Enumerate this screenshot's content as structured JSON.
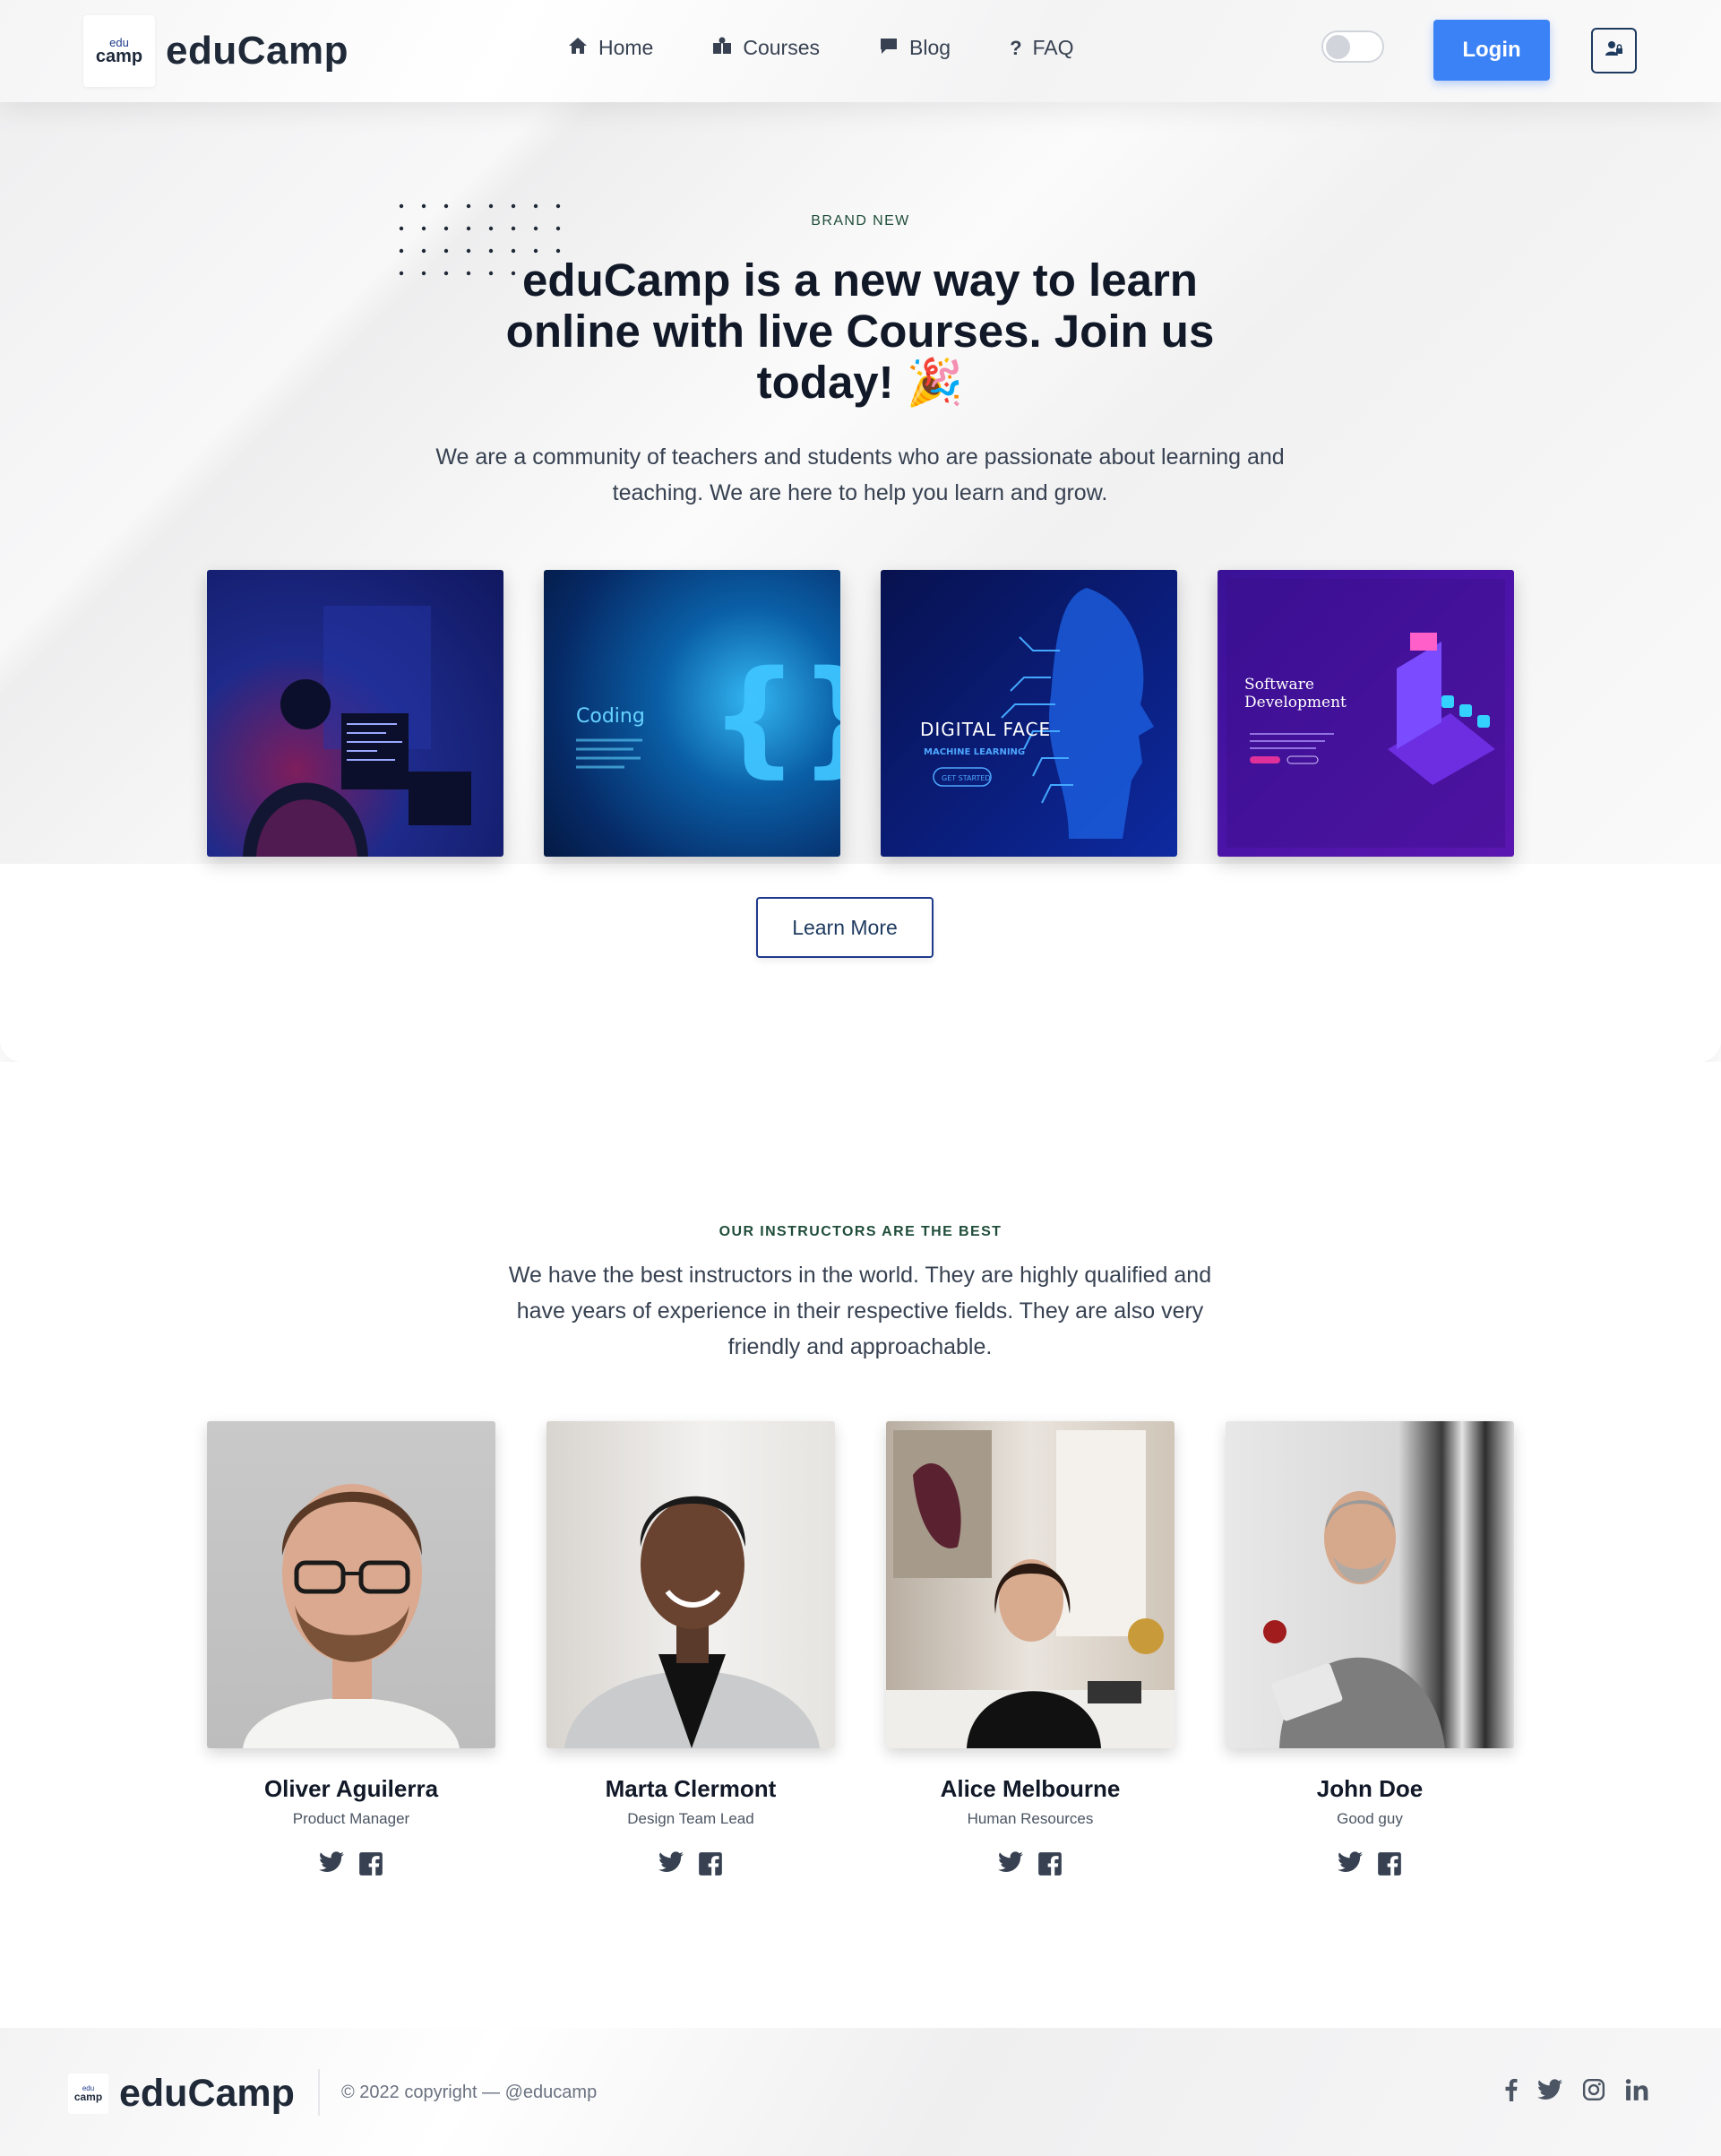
{
  "header": {
    "logo_top": "edu",
    "logo_bottom": "camp",
    "brand": "eduCamp",
    "nav": [
      {
        "label": "Home",
        "icon": "home-icon"
      },
      {
        "label": "Courses",
        "icon": "courses-icon"
      },
      {
        "label": "Blog",
        "icon": "blog-icon"
      },
      {
        "label": "FAQ",
        "icon": "question-icon"
      }
    ],
    "login_label": "Login",
    "theme_toggle": "off"
  },
  "hero": {
    "eyebrow": "BRAND NEW",
    "title": "eduCamp is a new way to learn online with live Courses. Join us today!",
    "title_emoji": "🎉",
    "description": "We are a community of teachers and students who are passionate about learning and teaching. We are here to help you learn and grow.",
    "tiles": [
      {
        "label": ""
      },
      {
        "label": "Coding"
      },
      {
        "label": "DIGITAL FACE",
        "sub": "MACHINE LEARNING",
        "cta": "GET STARTED"
      },
      {
        "label": "Software Development"
      }
    ],
    "learn_more": "Learn More"
  },
  "instructors": {
    "eyebrow": "OUR INSTRUCTORS ARE THE BEST",
    "description": "We have the best instructors in the world. They are highly qualified and have years of experience in their respective fields. They are also very friendly and approachable.",
    "people": [
      {
        "name": "Oliver Aguilerra",
        "role": "Product Manager"
      },
      {
        "name": "Marta Clermont",
        "role": "Design Team Lead"
      },
      {
        "name": "Alice Melbourne",
        "role": "Human Resources"
      },
      {
        "name": "John Doe",
        "role": "Good guy"
      }
    ]
  },
  "footer": {
    "logo_top": "edu",
    "logo_bottom": "camp",
    "brand": "eduCamp",
    "copyright": "© 2022 copyright — @educamp",
    "social": [
      "facebook-icon",
      "twitter-icon",
      "instagram-icon",
      "linkedin-icon"
    ]
  },
  "colors": {
    "primary": "#3b82f6",
    "dark_navy": "#1e3a5f",
    "accent_green": "#1f4d3a"
  }
}
